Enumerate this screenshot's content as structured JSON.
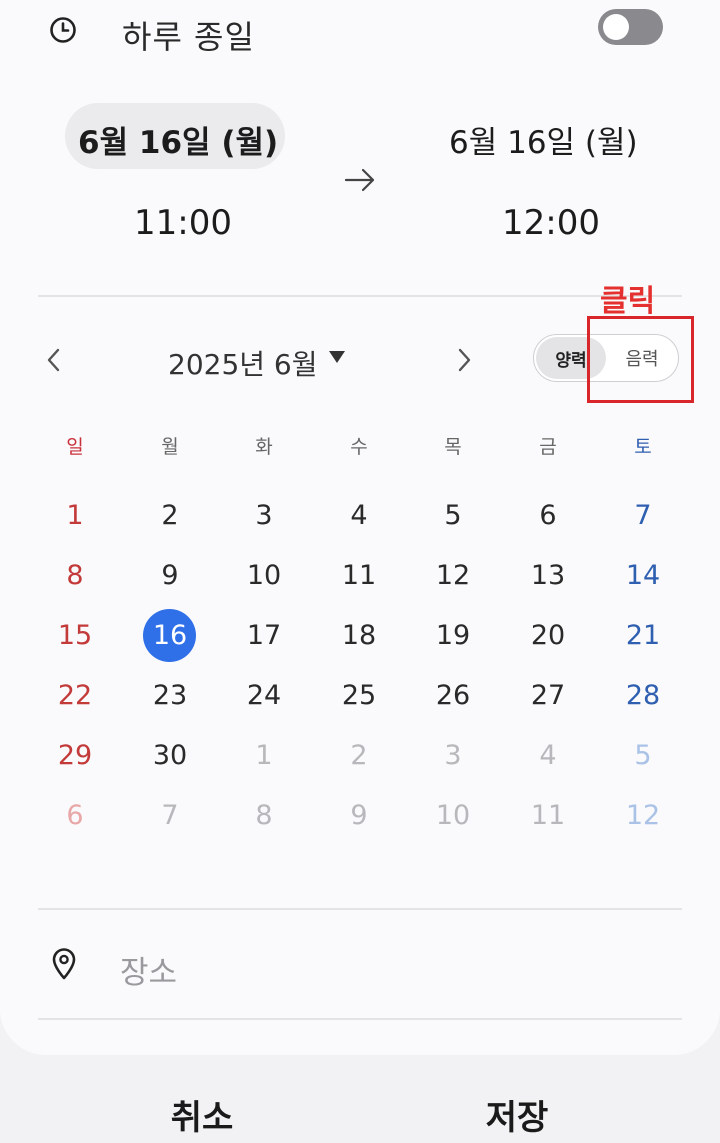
{
  "all_day": {
    "label": "하루 종일",
    "enabled": false,
    "icon": "clock-icon"
  },
  "start": {
    "date": "6월 16일 (월)",
    "time": "11:00"
  },
  "end": {
    "date": "6월 16일 (월)",
    "time": "12:00"
  },
  "calendar": {
    "month_label": "2025년 6월",
    "type_switch": {
      "solar_label": "양력",
      "lunar_label": "음력",
      "selected": "양력"
    },
    "weekdays": [
      "일",
      "월",
      "화",
      "수",
      "목",
      "금",
      "토"
    ],
    "weeks": [
      [
        "1",
        "2",
        "3",
        "4",
        "5",
        "6",
        "7"
      ],
      [
        "8",
        "9",
        "10",
        "11",
        "12",
        "13",
        "14"
      ],
      [
        "15",
        "16",
        "17",
        "18",
        "19",
        "20",
        "21"
      ],
      [
        "22",
        "23",
        "24",
        "25",
        "26",
        "27",
        "28"
      ],
      [
        "29",
        "30",
        "1",
        "2",
        "3",
        "4",
        "5"
      ],
      [
        "6",
        "7",
        "8",
        "9",
        "10",
        "11",
        "12"
      ]
    ],
    "selected_day": "16"
  },
  "annotation": {
    "label": "클릭",
    "color": "#d9262b"
  },
  "location": {
    "placeholder": "장소"
  },
  "buttons": {
    "cancel": "취소",
    "save": "저장"
  },
  "colors": {
    "accent": "#2f6fe8",
    "sunday": "#c33a3a",
    "saturday": "#2f5fb0"
  }
}
